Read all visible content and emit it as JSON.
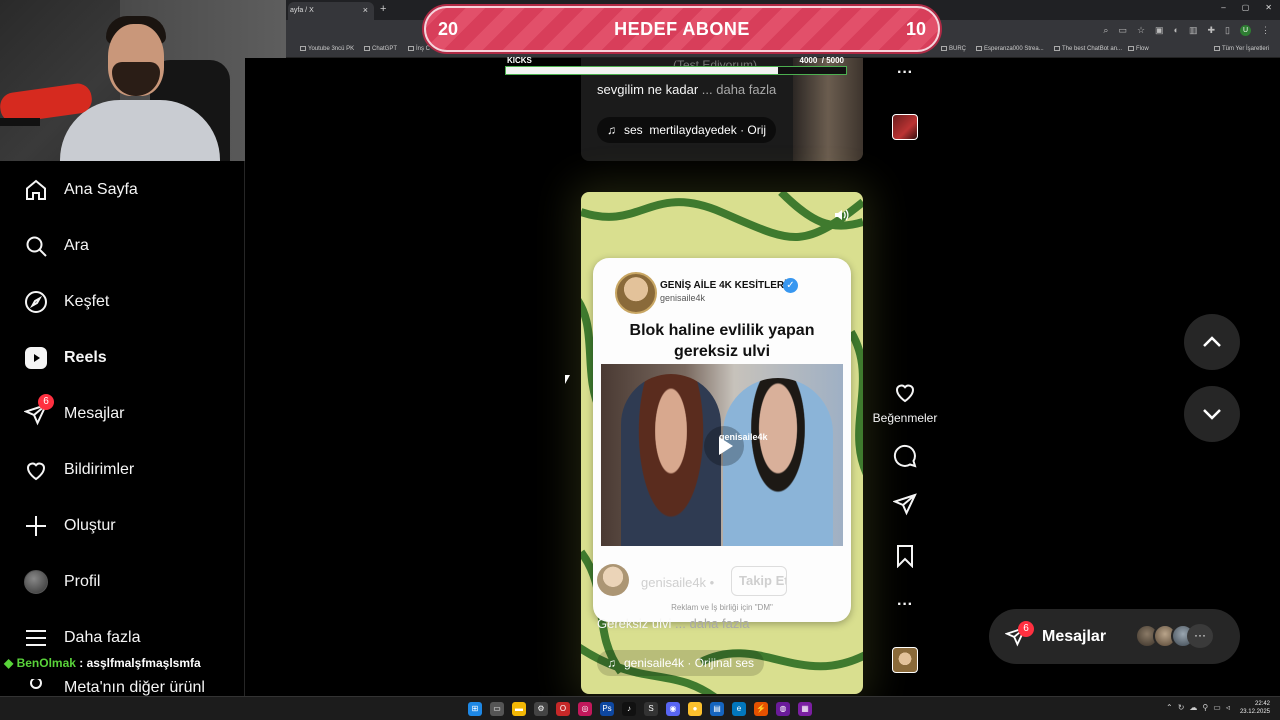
{
  "browser": {
    "tab_title": "ayfa / X",
    "tab_close": "×",
    "new_tab": "+",
    "window_controls": [
      "–",
      "▢",
      "✕"
    ],
    "toolbar_icons": [
      "search-icon",
      "cast-icon",
      "star-icon",
      "extensions-icon",
      "translate-icon",
      "bookmark-icon",
      "puzzle-icon",
      "sidebar-icon",
      "menu-icon"
    ],
    "profile_letter": "U",
    "bookmarks": [
      "Youtube 3ncü PK",
      "ChatGPT",
      "İnş C",
      "BURÇ",
      "Esperanza000 Strea...",
      "The best ChatBot an...",
      "Flow",
      "Tüm Yer İşaretleri"
    ]
  },
  "goal": {
    "left_value": "20",
    "title": "HEDEF ABONE",
    "right_value": "10",
    "color": "#e2506a"
  },
  "kicks": {
    "label": "KICKS",
    "count": "4000",
    "total": "/ 5000",
    "progress": 0.8,
    "ghost_text": "(Test Ediyorum)"
  },
  "sidebar": {
    "items": [
      {
        "label": "Ana Sayfa",
        "icon": "home-icon"
      },
      {
        "label": "Ara",
        "icon": "search-icon"
      },
      {
        "label": "Keşfet",
        "icon": "compass-icon"
      },
      {
        "label": "Reels",
        "icon": "reels-icon"
      },
      {
        "label": "Mesajlar",
        "icon": "messenger-icon",
        "badge": "6"
      },
      {
        "label": "Bildirimler",
        "icon": "heart-icon"
      },
      {
        "label": "Oluştur",
        "icon": "plus-icon"
      },
      {
        "label": "Profil",
        "icon": "profile-avatar"
      },
      {
        "label": "Daha fazla",
        "icon": "menu-icon"
      },
      {
        "label": "Meta'nın diğer ürünl",
        "icon": "meta-icon"
      }
    ]
  },
  "chat": {
    "gem": "◆",
    "user": "BenOlmak",
    "separator": " : ",
    "message": "asşlfmalşfmaşlsmfa"
  },
  "prev_reel": {
    "caption": "sevgilim ne kadar",
    "more": "... daha fazla",
    "audio_prefix": "ses",
    "audio": "mertilaydayedek · Orij"
  },
  "reel": {
    "card": {
      "account_name": "GENİŞ AİLE 4K KESİTLERİ",
      "verified": "✓",
      "handle": "genisaile4k",
      "title_line1": "Blok haline evlilik yapan",
      "title_line2": "gereksiz ulvi",
      "watermark": "genisaile4k",
      "footer_handle": "genisaile4k",
      "footer_dot": "•",
      "follow": "Takip Et",
      "footer_note": "Reklam ve İş birliği için \"DM\""
    },
    "caption": "Gereksiz ulvi",
    "more": "... daha fazla",
    "audio": "genisaile4k · Orijinal ses",
    "bg_color": "#d9df8f",
    "line_color": "#3f7a2e"
  },
  "actions": {
    "top_more": "···",
    "like_label": "Beğenmeler",
    "more": "···"
  },
  "messages_pill": {
    "label": "Mesajlar",
    "badge": "6",
    "more": "···"
  },
  "clock": {
    "time": "22:42",
    "date": "23.12.2025"
  }
}
